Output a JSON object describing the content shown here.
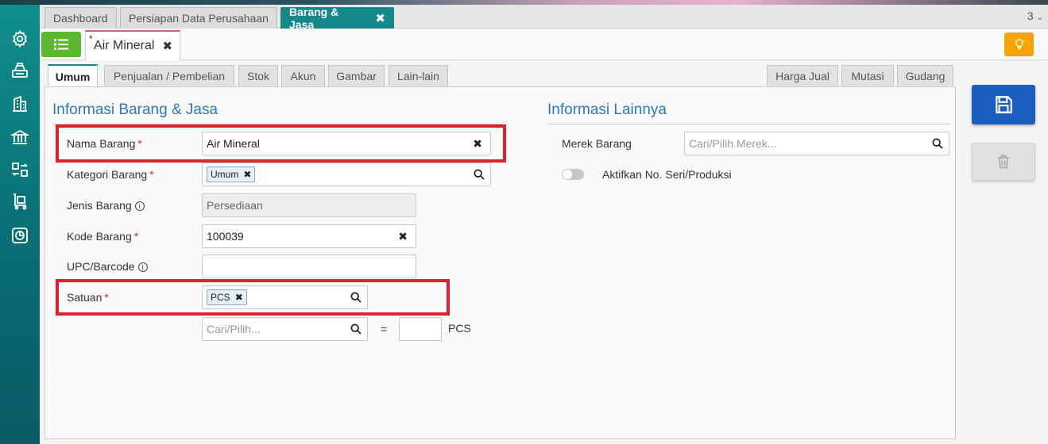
{
  "app_tabs": [
    {
      "label": "Dashboard"
    },
    {
      "label": "Persiapan Data Perusahaan"
    },
    {
      "label": "Barang & Jasa",
      "close": "✖"
    }
  ],
  "tab_count": "3",
  "doc_tab": {
    "modified_marker": "*",
    "label": "Air Mineral",
    "close": "✖"
  },
  "sub_tabs_left": [
    "Umum",
    "Penjualan / Pembelian",
    "Stok",
    "Akun",
    "Gambar",
    "Lain-lain"
  ],
  "sub_tabs_right": [
    "Harga Jual",
    "Mutasi",
    "Gudang"
  ],
  "info_barang": {
    "title": "Informasi Barang & Jasa",
    "nama_barang": {
      "label": "Nama Barang",
      "required": "*",
      "value": "Air Mineral",
      "clear": "✖"
    },
    "kategori_barang": {
      "label": "Kategori Barang",
      "required": "*",
      "chip": "Umum",
      "chip_remove": "✖"
    },
    "jenis_barang": {
      "label": "Jenis Barang",
      "info": "i",
      "value": "Persediaan"
    },
    "kode_barang": {
      "label": "Kode Barang",
      "required": "*",
      "value": "100039",
      "clear": "✖"
    },
    "upc_barcode": {
      "label": "UPC/Barcode",
      "info": "i",
      "value": ""
    },
    "satuan": {
      "label": "Satuan",
      "required": "*",
      "chip": "PCS",
      "chip_remove": "✖"
    },
    "konversi": {
      "placeholder": "Cari/Pilih...",
      "equals": "=",
      "qty": "",
      "unit": "PCS"
    }
  },
  "info_lainnya": {
    "title": "Informasi Lainnya",
    "merek_barang": {
      "label": "Merek Barang",
      "placeholder": "Cari/Pilih Merek..."
    },
    "serial_toggle": {
      "label": "Aktifkan No. Seri/Produksi",
      "enabled": false
    }
  },
  "colors": {
    "accent_teal": "#14898c",
    "primary_blue": "#1a5fbf",
    "section_title": "#2b78c2",
    "highlight_red": "#e0202a",
    "menu_green": "#5cb82e",
    "bulb_orange": "#f7a400"
  },
  "icons": {
    "sidebar": [
      "gear-icon",
      "cash-register-icon",
      "building-icon",
      "bank-icon",
      "transfer-icon",
      "trolley-icon",
      "report-chart-icon"
    ],
    "menu": "list-icon",
    "bulb": "lightbulb-icon",
    "save": "floppy-disk-icon",
    "delete": "trash-icon",
    "search": "magnifier-icon"
  }
}
